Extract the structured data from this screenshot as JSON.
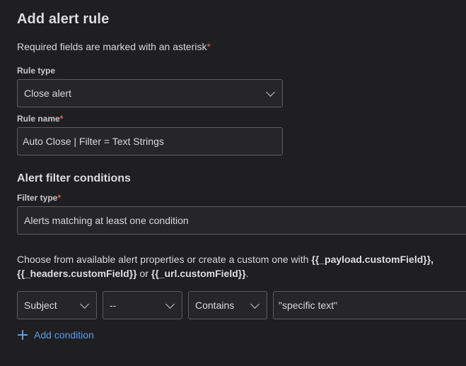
{
  "form": {
    "title": "Add alert rule",
    "required_note": "Required fields are marked with an asterisk",
    "required_marker": "*",
    "rule_type": {
      "label": "Rule type",
      "value": "Close alert"
    },
    "rule_name": {
      "label": "Rule name",
      "value": "Auto Close | Filter = Text Strings"
    },
    "filter_section": {
      "title": "Alert filter conditions",
      "filter_type_label": "Filter type",
      "filter_type_value": "Alerts matching at least one condition",
      "help_prefix": "Choose from available alert properties or create a custom one with ",
      "help_token_1": "{{_payload.customField}},",
      "help_token_2": "{{_headers.customField}}",
      "help_or": " or ",
      "help_token_3": "{{_url.customField}}",
      "help_suffix": "."
    },
    "condition": {
      "property": "Subject",
      "modifier": "--",
      "operator": "Contains",
      "value": "\"specific text\""
    },
    "add_condition_label": "Add condition"
  },
  "colors": {
    "background": "#1f1f21",
    "field_background": "#262628",
    "border": "#5c5c60",
    "required": "#f0605a",
    "link": "#5b9cf0"
  },
  "icons": [
    "chevron-down-icon",
    "plus-icon"
  ]
}
